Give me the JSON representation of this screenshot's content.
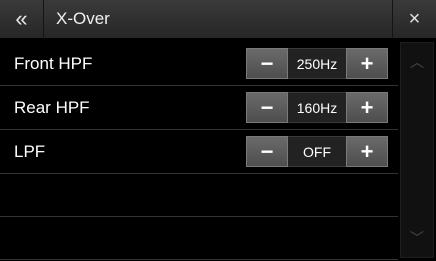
{
  "header": {
    "back_icon": "«",
    "title": "X-Over",
    "close_icon": "×"
  },
  "rows": [
    {
      "label": "Front HPF",
      "minus": "−",
      "value": "250Hz",
      "plus": "+"
    },
    {
      "label": "Rear HPF",
      "minus": "−",
      "value": "160Hz",
      "plus": "+"
    },
    {
      "label": "LPF",
      "minus": "−",
      "value": "OFF",
      "plus": "+"
    }
  ],
  "scrollbar": {
    "up_icon": "︿",
    "down_icon": "﹀"
  },
  "colors": {
    "background": "#000000",
    "header": "#303030",
    "button": "#5c5c5c"
  }
}
